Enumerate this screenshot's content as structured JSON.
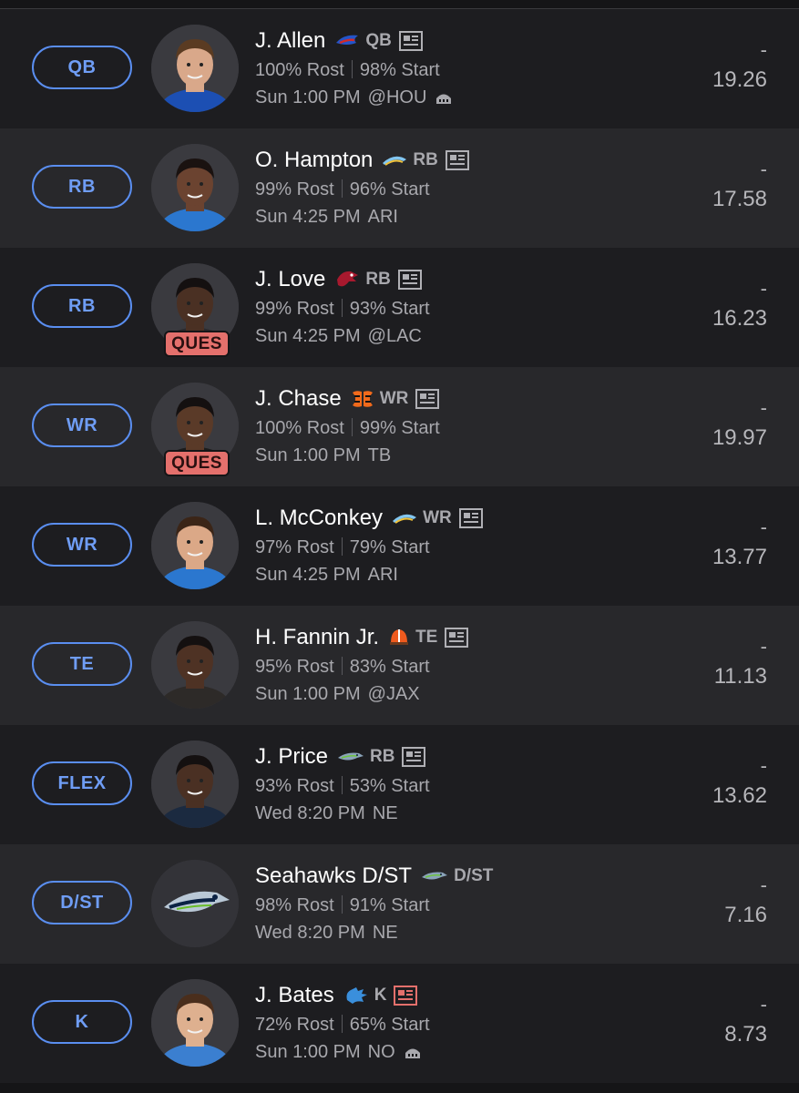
{
  "colors": {
    "accent": "#5a8ef0",
    "ques": "#e4706c",
    "bg_odd": "#1d1d20",
    "bg_even": "#28282b"
  },
  "players": [
    {
      "slot": "QB",
      "name": "J. Allen",
      "team_logo": "bills-logo",
      "position": "QB",
      "rost": "100% Rost",
      "start": "98% Start",
      "day": "Sun",
      "time": "1:00 PM",
      "opponent": "@HOU",
      "weather_icon": "dome-icon",
      "status": "",
      "dash": "-",
      "projection": "19.26",
      "news_icon": "news-icon",
      "skin": "#d9a88a",
      "hair": "#5a3b22",
      "jersey": "#1c4fb3"
    },
    {
      "slot": "RB",
      "name": "O. Hampton",
      "team_logo": "chargers-logo",
      "position": "RB",
      "rost": "99% Rost",
      "start": "96% Start",
      "day": "Sun",
      "time": "4:25 PM",
      "opponent": "ARI",
      "weather_icon": "",
      "status": "",
      "dash": "-",
      "projection": "17.58",
      "news_icon": "news-icon",
      "skin": "#6b4330",
      "hair": "#1a1210",
      "jersey": "#2b77cf"
    },
    {
      "slot": "RB",
      "name": "J. Love",
      "team_logo": "cardinals-logo",
      "position": "RB",
      "rost": "99% Rost",
      "start": "93% Start",
      "day": "Sun",
      "time": "4:25 PM",
      "opponent": "@LAC",
      "weather_icon": "",
      "status": "QUES",
      "dash": "-",
      "projection": "16.23",
      "news_icon": "news-icon",
      "skin": "#4a3023",
      "hair": "#141010",
      "jersey": "#2a2a2e"
    },
    {
      "slot": "WR",
      "name": "J. Chase",
      "team_logo": "bengals-logo",
      "position": "WR",
      "rost": "100% Rost",
      "start": "99% Start",
      "day": "Sun",
      "time": "1:00 PM",
      "opponent": "TB",
      "weather_icon": "",
      "status": "QUES",
      "dash": "-",
      "projection": "19.97",
      "news_icon": "news-icon",
      "skin": "#5a3a28",
      "hair": "#141010",
      "jersey": "#1c1c1c"
    },
    {
      "slot": "WR",
      "name": "L. McConkey",
      "team_logo": "chargers-logo",
      "position": "WR",
      "rost": "97% Rost",
      "start": "79% Start",
      "day": "Sun",
      "time": "4:25 PM",
      "opponent": "ARI",
      "weather_icon": "",
      "status": "",
      "dash": "-",
      "projection": "13.77",
      "news_icon": "news-icon",
      "skin": "#dba887",
      "hair": "#3b2517",
      "jersey": "#2b77cf"
    },
    {
      "slot": "TE",
      "name": "H. Fannin Jr.",
      "team_logo": "browns-logo",
      "position": "TE",
      "rost": "95% Rost",
      "start": "83% Start",
      "day": "Sun",
      "time": "1:00 PM",
      "opponent": "@JAX",
      "weather_icon": "",
      "status": "",
      "dash": "-",
      "projection": "11.13",
      "news_icon": "news-icon",
      "skin": "#4e3224",
      "hair": "#141010",
      "jersey": "#2d2a28"
    },
    {
      "slot": "FLEX",
      "name": "J. Price",
      "team_logo": "seahawks-logo",
      "position": "RB",
      "rost": "93% Rost",
      "start": "53% Start",
      "day": "Wed",
      "time": "8:20 PM",
      "opponent": "NE",
      "weather_icon": "",
      "status": "",
      "dash": "-",
      "projection": "13.62",
      "news_icon": "news-icon",
      "skin": "#4a3023",
      "hair": "#141010",
      "jersey": "#1b2a40"
    },
    {
      "slot": "D/ST",
      "name": "Seahawks D/ST",
      "team_logo": "seahawks-logo",
      "position": "D/ST",
      "rost": "98% Rost",
      "start": "91% Start",
      "day": "Wed",
      "time": "8:20 PM",
      "opponent": "NE",
      "weather_icon": "",
      "status": "",
      "dash": "-",
      "projection": "7.16",
      "news_icon": "",
      "skin": "",
      "hair": "",
      "jersey": ""
    },
    {
      "slot": "K",
      "name": "J. Bates",
      "team_logo": "lions-logo",
      "position": "K",
      "rost": "72% Rost",
      "start": "65% Start",
      "day": "Sun",
      "time": "1:00 PM",
      "opponent": "NO",
      "weather_icon": "dome-icon",
      "status": "",
      "dash": "-",
      "projection": "8.73",
      "news_icon": "news-icon-red",
      "skin": "#deb08f",
      "hair": "#4a2e1c",
      "jersey": "#3b7fd0"
    }
  ]
}
